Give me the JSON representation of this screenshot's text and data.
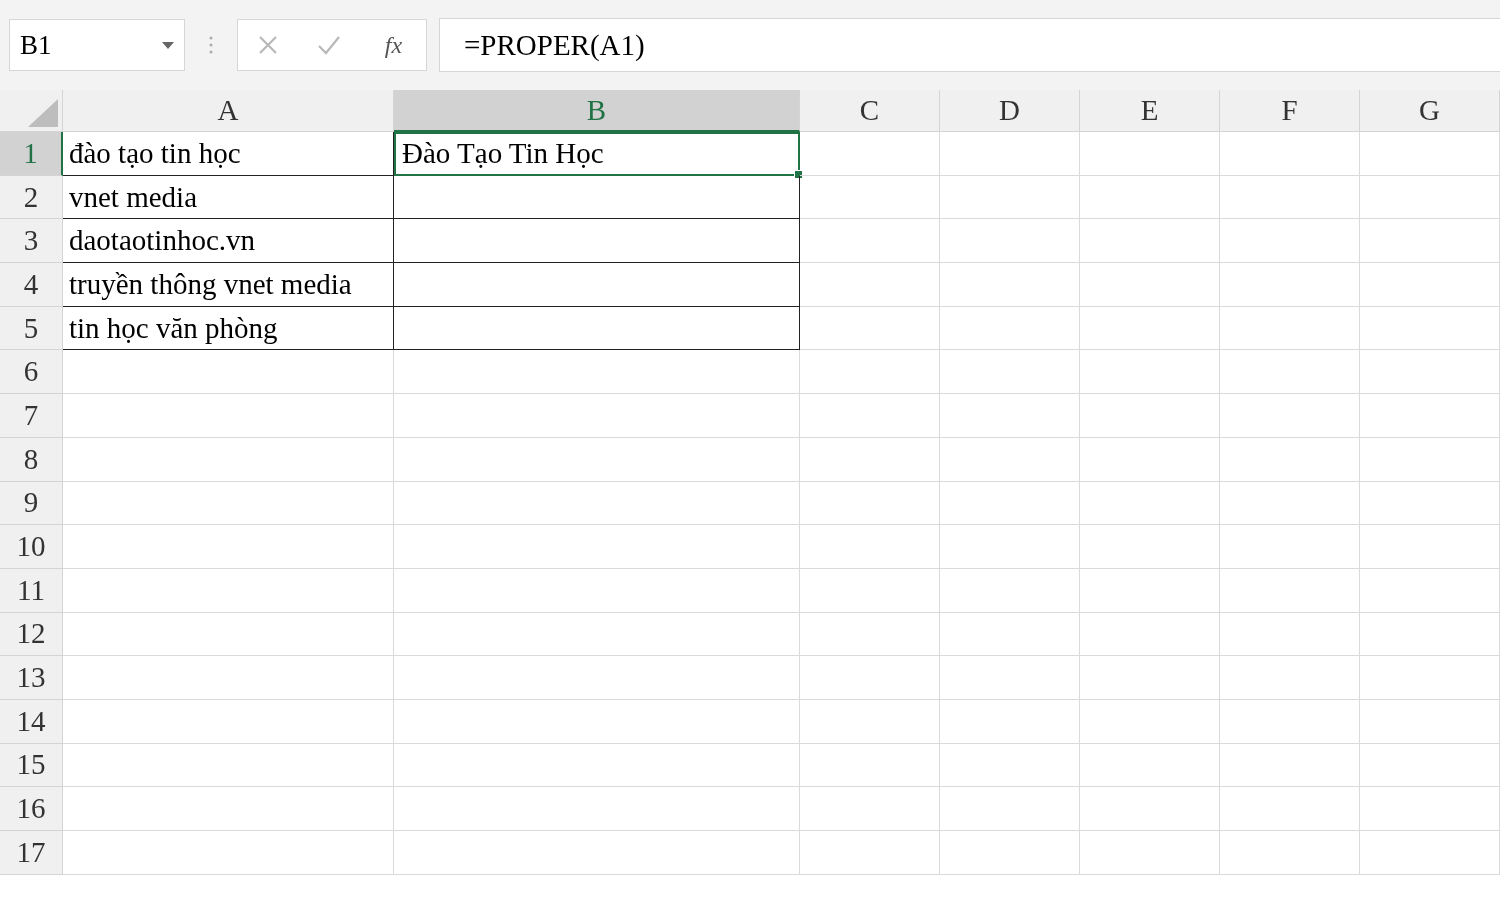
{
  "name_box": {
    "value": "B1"
  },
  "formula_bar": {
    "function_label": "fx",
    "value": "=PROPER(A1)"
  },
  "columns": [
    {
      "label": "A",
      "selected": false
    },
    {
      "label": "B",
      "selected": true
    },
    {
      "label": "C",
      "selected": false
    },
    {
      "label": "D",
      "selected": false
    },
    {
      "label": "E",
      "selected": false
    },
    {
      "label": "F",
      "selected": false
    },
    {
      "label": "G",
      "selected": false
    }
  ],
  "rows": [
    {
      "number": "1",
      "selected": true,
      "bordered": true,
      "cells": [
        "đào tạo tin học",
        "Đào Tạo Tin Học"
      ]
    },
    {
      "number": "2",
      "selected": false,
      "bordered": true,
      "cells": [
        "vnet media",
        ""
      ]
    },
    {
      "number": "3",
      "selected": false,
      "bordered": true,
      "cells": [
        "daotaotinhoc.vn",
        ""
      ]
    },
    {
      "number": "4",
      "selected": false,
      "bordered": true,
      "cells": [
        "truyền thông vnet media",
        ""
      ]
    },
    {
      "number": "5",
      "selected": false,
      "bordered": true,
      "cells": [
        "tin học văn phòng",
        ""
      ]
    },
    {
      "number": "6",
      "selected": false,
      "bordered": false,
      "cells": []
    },
    {
      "number": "7",
      "selected": false,
      "bordered": false,
      "cells": []
    },
    {
      "number": "8",
      "selected": false,
      "bordered": false,
      "cells": []
    },
    {
      "number": "9",
      "selected": false,
      "bordered": false,
      "cells": []
    },
    {
      "number": "10",
      "selected": false,
      "bordered": false,
      "cells": []
    },
    {
      "number": "11",
      "selected": false,
      "bordered": false,
      "cells": []
    },
    {
      "number": "12",
      "selected": false,
      "bordered": false,
      "cells": []
    },
    {
      "number": "13",
      "selected": false,
      "bordered": false,
      "cells": []
    },
    {
      "number": "14",
      "selected": false,
      "bordered": false,
      "cells": []
    },
    {
      "number": "15",
      "selected": false,
      "bordered": false,
      "cells": []
    },
    {
      "number": "16",
      "selected": false,
      "bordered": false,
      "cells": []
    },
    {
      "number": "17",
      "selected": false,
      "bordered": false,
      "cells": []
    }
  ]
}
